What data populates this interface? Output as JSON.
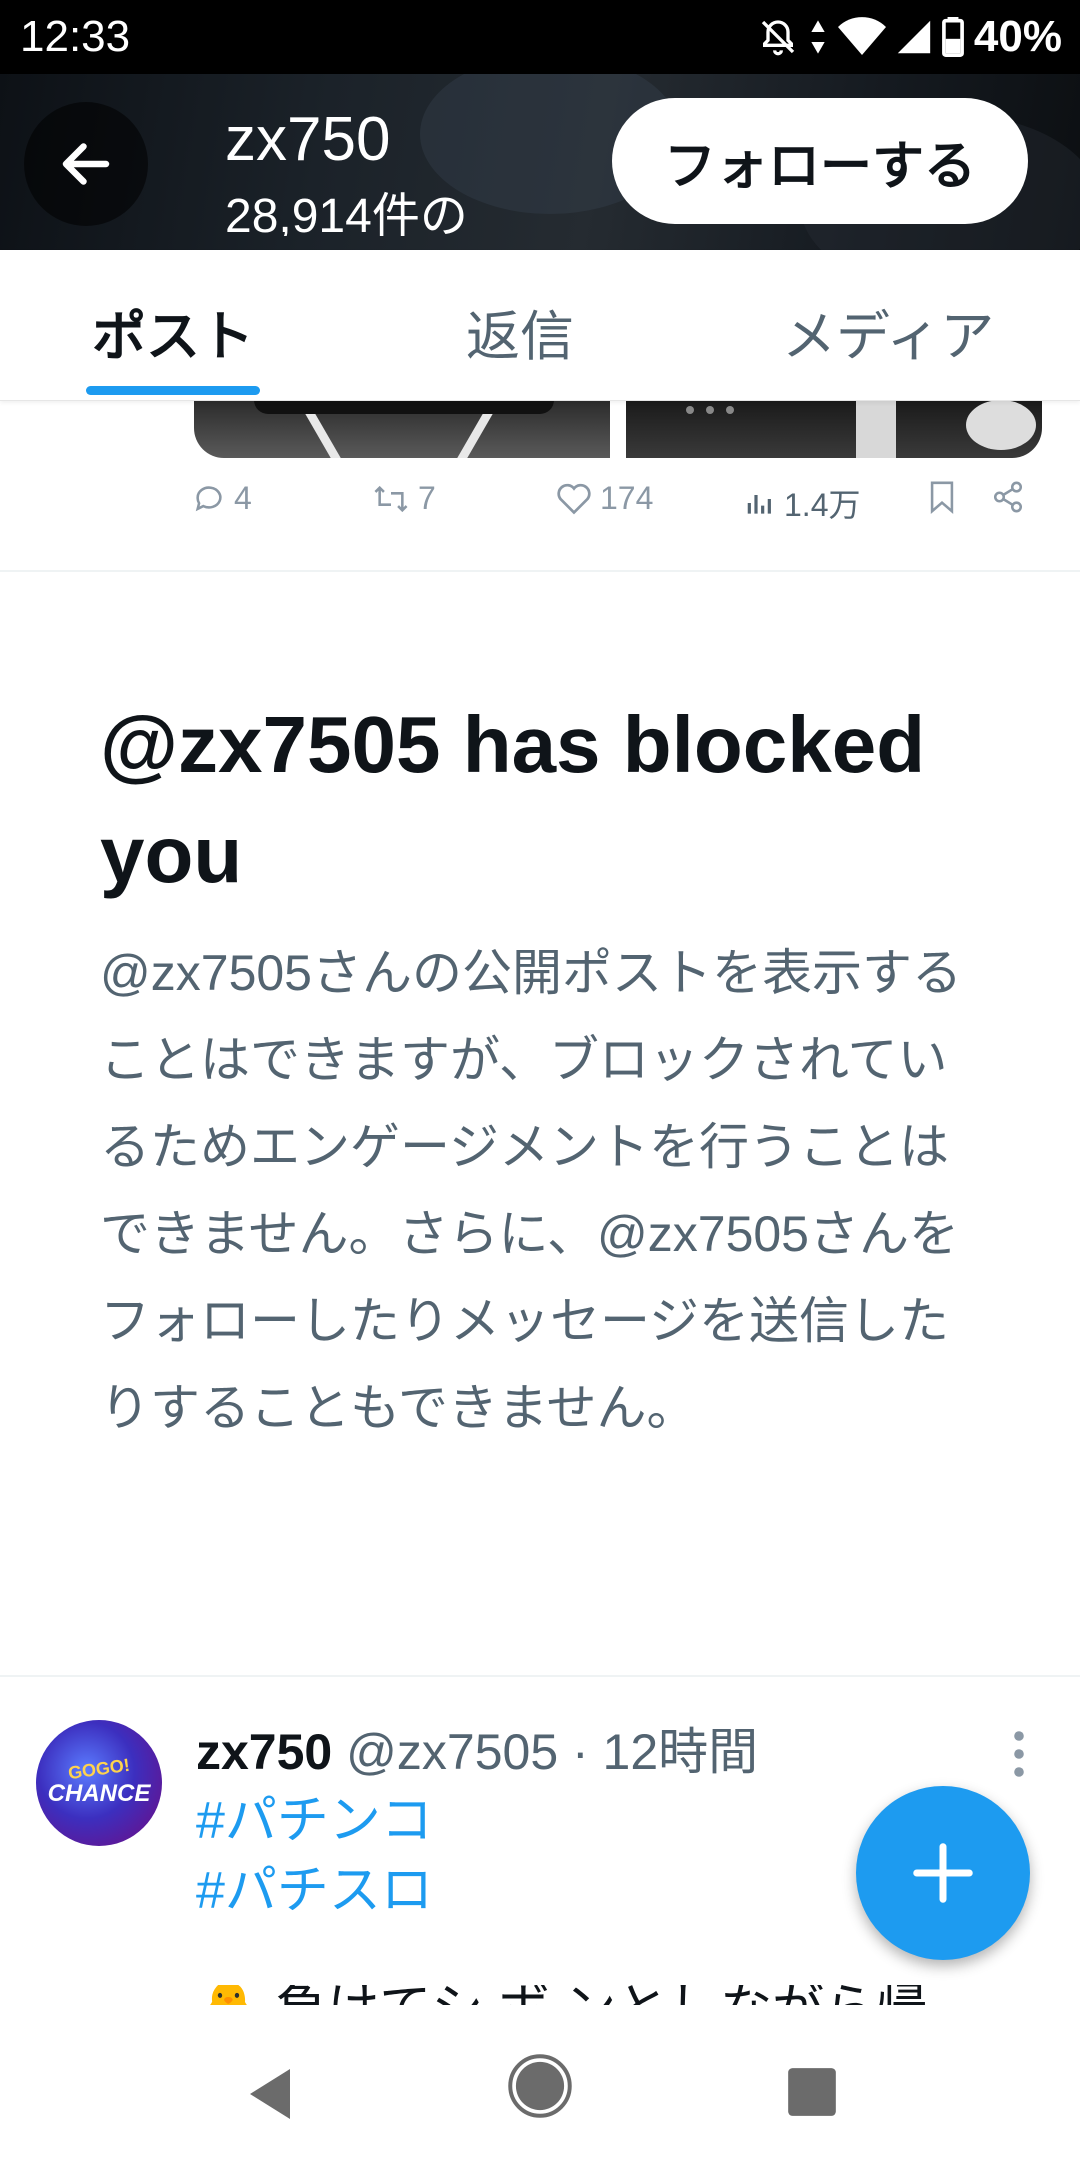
{
  "status_bar": {
    "time": "12:33",
    "battery": "40%",
    "icons": [
      "bell-off-icon",
      "data-arrows-icon",
      "wifi-icon",
      "signal-icon",
      "battery-icon"
    ]
  },
  "header": {
    "name": "zx750",
    "post_count": "28,914件の",
    "follow_label": "フォローする"
  },
  "tabs": [
    {
      "label": "ポスト",
      "active": true
    },
    {
      "label": "返信",
      "active": false
    },
    {
      "label": "メディア",
      "active": false
    }
  ],
  "prev_tweet": {
    "replies": "4",
    "reposts": "7",
    "likes": "174",
    "views": "1.4万"
  },
  "blocked": {
    "title": "@zx7505 has blocked you",
    "description": "@zx7505さんの公開ポストを表示することはできますが、ブロックされているためエンゲージメントを行うことはできません。さらに、@zx7505さんをフォローしたりメッセージを送信したりすることもできません。"
  },
  "tweet": {
    "name": "zx750",
    "meta": "@zx7505 · 12時間",
    "hashtags": [
      "#パチンコ",
      "#パチスロ"
    ],
    "clipped_text": "🐥 負けてシ ボ ンとしながら帰",
    "avatar_text_1": "GOGO!",
    "avatar_text_2": "CHANCE"
  },
  "colors": {
    "accent": "#1d9bf0",
    "text_primary": "#0f1419",
    "text_secondary": "#536471"
  }
}
